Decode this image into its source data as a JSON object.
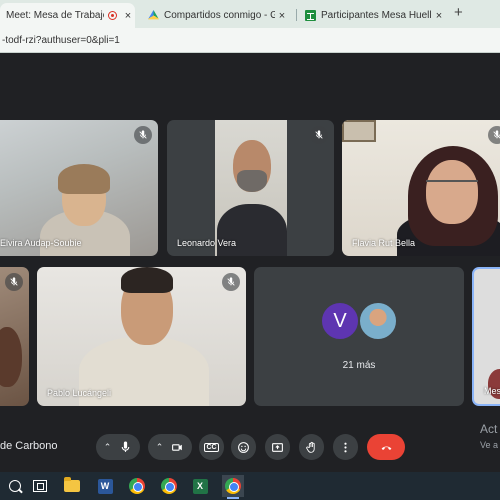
{
  "browser": {
    "tabs": [
      {
        "label": "Meet: Mesa de Trabajo Huel",
        "close": "×"
      },
      {
        "label": "Compartidos conmigo - Google",
        "close": "×"
      },
      {
        "label": "Participantes Mesa Huella de C",
        "close": "×"
      }
    ],
    "new_tab": "+",
    "address": "-todf-rzi?authuser=0&pli=1"
  },
  "meet": {
    "participants": [
      {
        "name": "Elvira Audap-Soubie"
      },
      {
        "name": "Leonardo Vera"
      },
      {
        "name": "Flavia Rut Bella"
      },
      {
        "name": "Pablo Lucángeli"
      },
      {
        "name": "Mes"
      }
    ],
    "others": {
      "avatar_letter": "V",
      "label": "21 más"
    },
    "meeting_name": "de Carbono",
    "side_text_1": "Act",
    "side_text_2": "Ve a",
    "colors": {
      "end_call": "#ea4335",
      "avatar_v": "#5e35b1",
      "active_border": "#8ab4f8"
    }
  },
  "controls": {
    "icons": [
      "chevron-up-icon",
      "mic-icon",
      "chevron-up-icon",
      "camera-icon",
      "captions-icon",
      "emoji-icon",
      "present-icon",
      "raise-hand-icon",
      "more-options-icon",
      "end-call-icon"
    ],
    "captions_label": "CC"
  },
  "taskbar": {
    "word_letter": "W",
    "excel_letter": "X"
  }
}
